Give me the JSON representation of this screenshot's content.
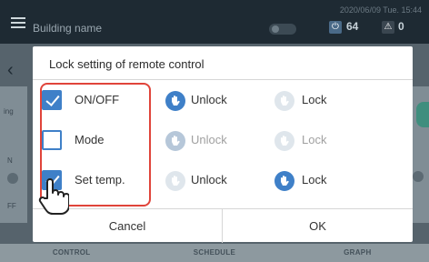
{
  "topbar": {
    "building_name": "Building name",
    "datetime": "2020/06/09 Tue. 15:44",
    "power_count": "64",
    "alert_count": "0",
    "power_icon": "power-icon",
    "alert_icon": "warning-icon"
  },
  "background": {
    "left_text_1": "ing",
    "left_text_2": "N",
    "left_text_3": "FF"
  },
  "dialog": {
    "title": "Lock setting of remote control",
    "rows": [
      {
        "label": "ON/OFF",
        "checked": true,
        "unlock": "Unlock",
        "lock": "Lock",
        "selected": "unlock"
      },
      {
        "label": "Mode",
        "checked": false,
        "unlock": "Unlock",
        "lock": "Lock",
        "selected": "none"
      },
      {
        "label": "Set temp.",
        "checked": true,
        "unlock": "Unlock",
        "lock": "Lock",
        "selected": "lock"
      }
    ],
    "cancel_label": "Cancel",
    "ok_label": "OK"
  },
  "bottom_nav": {
    "items": [
      "CONTROL",
      "SCHEDULE",
      "GRAPH"
    ]
  },
  "colors": {
    "accent": "#3f80c8",
    "highlight": "#e0443a"
  }
}
